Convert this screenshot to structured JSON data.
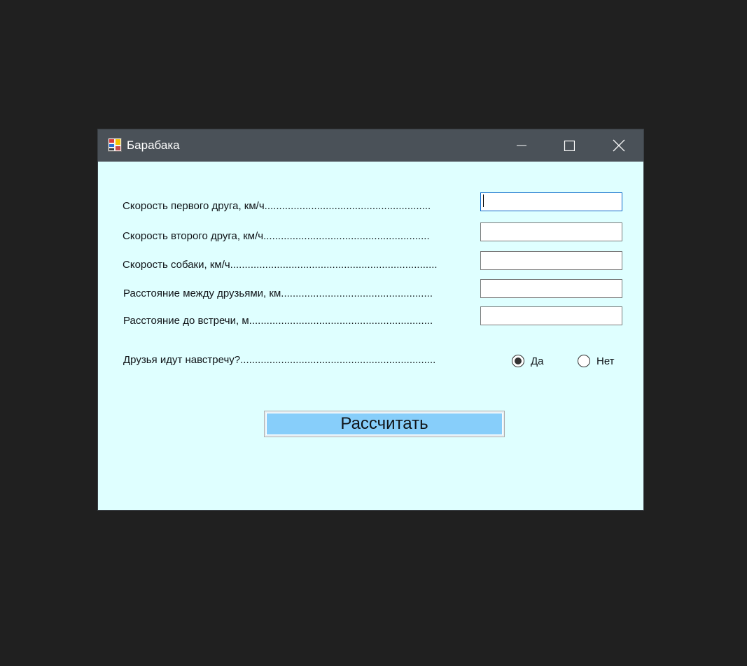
{
  "window": {
    "title": "Барабака",
    "icon": "app-form-icon",
    "controls": [
      "minimize-icon",
      "maximize-icon",
      "close-icon"
    ]
  },
  "form": {
    "fields": [
      {
        "label": "Скорость первого друга, км/ч.........................................................",
        "value": "",
        "focused": true
      },
      {
        "label": "Скорость второго друга, км/ч.........................................................",
        "value": ""
      },
      {
        "label": "Скорость собаки, км/ч.......................................................................",
        "value": ""
      },
      {
        "label": "Расстояние между друзьями, км....................................................",
        "value": ""
      },
      {
        "label": "Расстояние до встречи, м...............................................................",
        "value": ""
      }
    ],
    "question": {
      "label": "Друзья идут навстречу?...................................................................",
      "options": [
        {
          "label": "Да",
          "selected": true
        },
        {
          "label": "Нет",
          "selected": false
        }
      ]
    },
    "submit_label": "Рассчитать"
  },
  "colors": {
    "background": "#202020",
    "titlebar": "#4a5158",
    "window_body": "#dfffff",
    "button_fill": "#87cefa",
    "focus_border": "#0a68c9"
  }
}
